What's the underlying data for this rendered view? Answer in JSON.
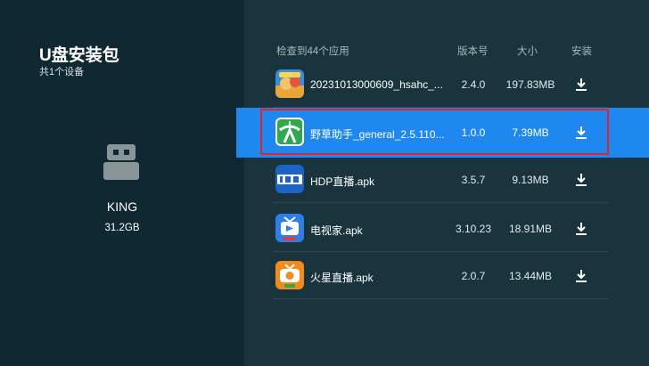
{
  "sidebar": {
    "title": "U盘安装包",
    "subtitle": "共1个设备",
    "device": {
      "name": "KING",
      "size": "31.2GB",
      "icon": "usb-drive-icon"
    }
  },
  "list": {
    "headers": {
      "name": "检查到44个应用",
      "version": "版本号",
      "size": "大小",
      "install": "安装"
    },
    "rows": [
      {
        "name": "20231013000609_hsahc_...",
        "version": "2.4.0",
        "size": "197.83MB",
        "icon": "game-app-icon"
      },
      {
        "name": "野草助手_general_2.5.110...",
        "version": "1.0.0",
        "size": "7.39MB",
        "icon": "yecao-app-icon",
        "selected": true
      },
      {
        "name": "HDP直播.apk",
        "version": "3.5.7",
        "size": "9.13MB",
        "icon": "hdp-app-icon"
      },
      {
        "name": "电视家.apk",
        "version": "3.10.23",
        "size": "18.91MB",
        "icon": "dianshijia-app-icon"
      },
      {
        "name": "火星直播.apk",
        "version": "2.0.7",
        "size": "13.44MB",
        "icon": "huoxing-app-icon"
      }
    ]
  },
  "colors": {
    "accent": "#1e88f0",
    "focus_border": "#e0242f",
    "background": "#1a343d"
  }
}
